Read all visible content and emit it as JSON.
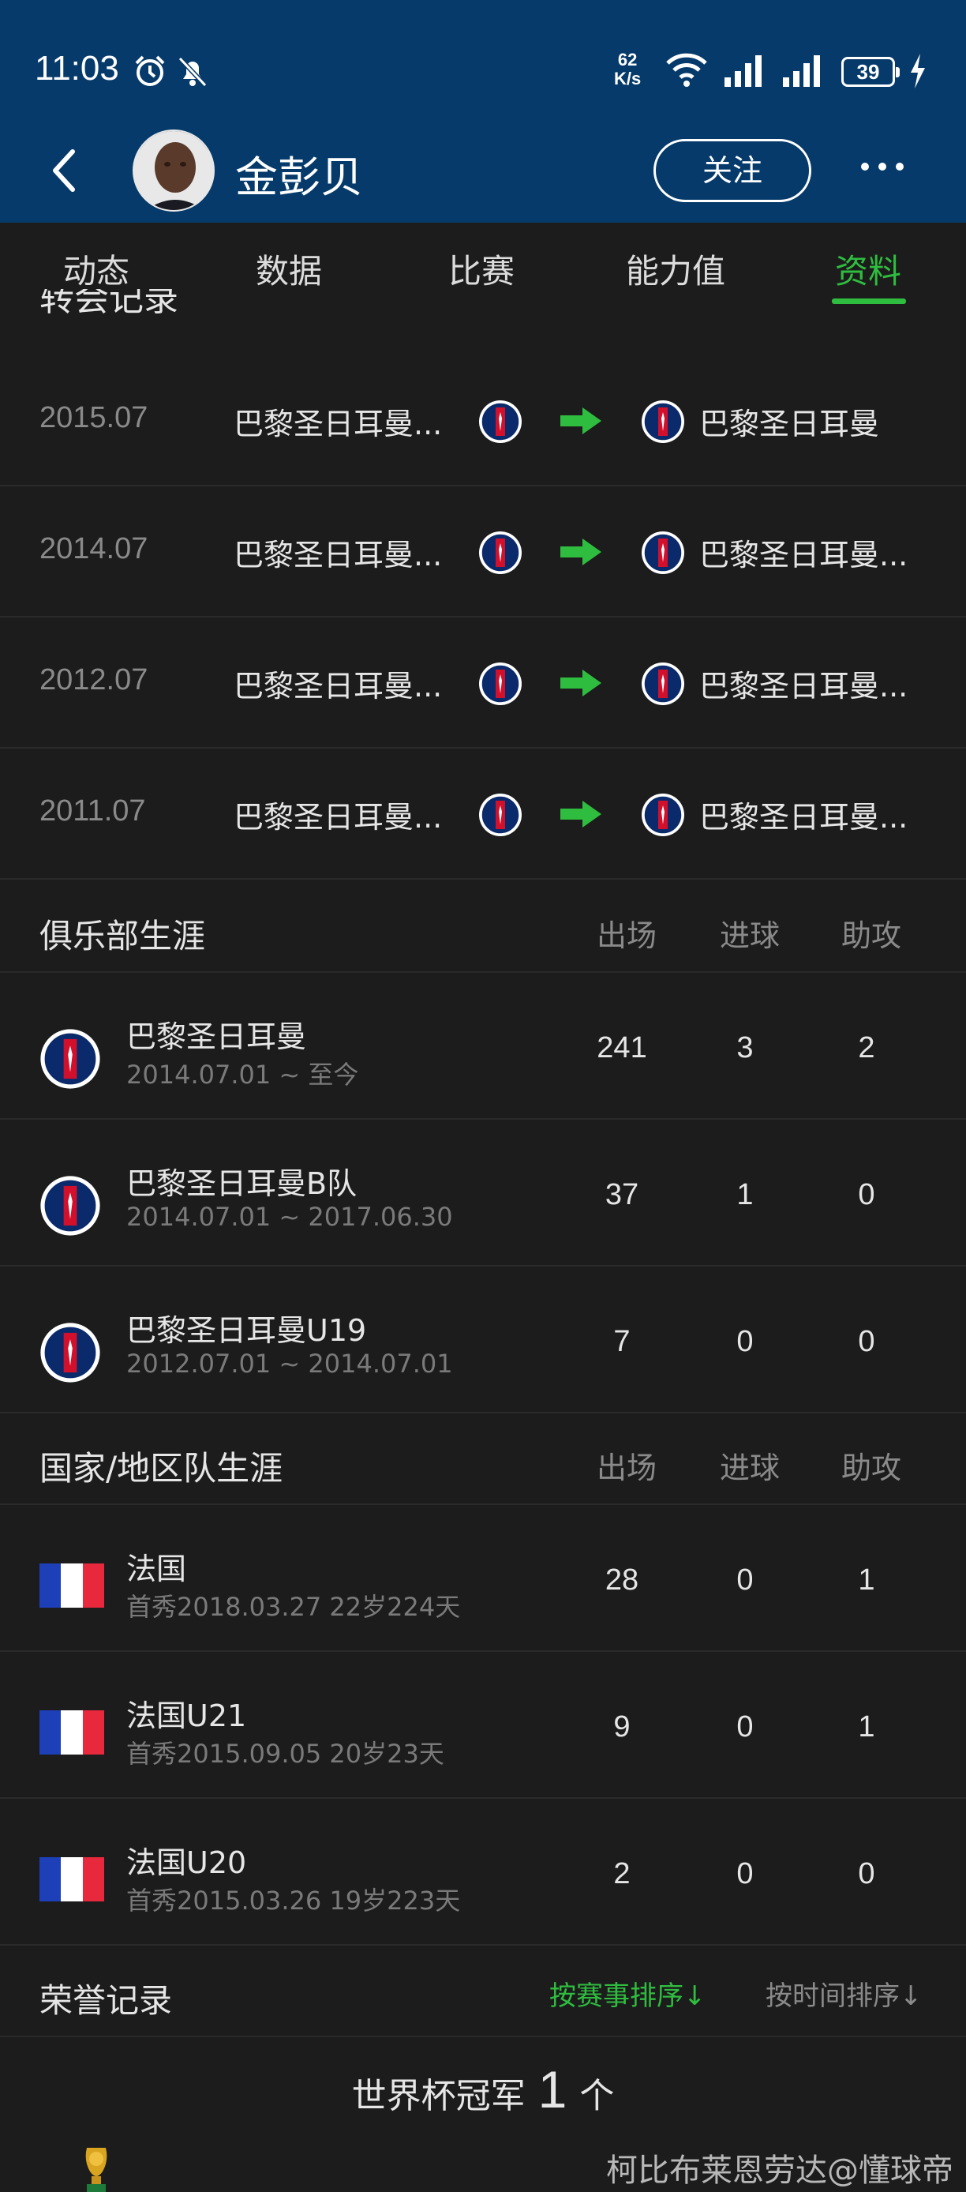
{
  "status": {
    "time": "11:03",
    "net_speed_value": "62",
    "net_speed_unit": "K/s",
    "battery": "39"
  },
  "header": {
    "name": "金彭贝",
    "follow": "关注"
  },
  "tabs": [
    {
      "label": "动态"
    },
    {
      "label": "数据"
    },
    {
      "label": "比赛"
    },
    {
      "label": "能力值"
    },
    {
      "label": "资料"
    }
  ],
  "active_tab": "资料",
  "transfer_section_title": "转会记录",
  "transfers": [
    {
      "date": "2015.07",
      "from": "巴黎圣日耳曼...",
      "to": "巴黎圣日耳曼"
    },
    {
      "date": "2014.07",
      "from": "巴黎圣日耳曼...",
      "to": "巴黎圣日耳曼..."
    },
    {
      "date": "2012.07",
      "from": "巴黎圣日耳曼...",
      "to": "巴黎圣日耳曼..."
    },
    {
      "date": "2011.07",
      "from": "巴黎圣日耳曼...",
      "to": "巴黎圣日耳曼..."
    }
  ],
  "club_career": {
    "title": "俱乐部生涯",
    "cols": {
      "apps": "出场",
      "goals": "进球",
      "assists": "助攻"
    },
    "rows": [
      {
        "name": "巴黎圣日耳曼",
        "period": "2014.07.01 ~ 至今",
        "apps": "241",
        "goals": "3",
        "assists": "2"
      },
      {
        "name": "巴黎圣日耳曼B队",
        "period": "2014.07.01 ~ 2017.06.30",
        "apps": "37",
        "goals": "1",
        "assists": "0"
      },
      {
        "name": "巴黎圣日耳曼U19",
        "period": "2012.07.01 ~ 2014.07.01",
        "apps": "7",
        "goals": "0",
        "assists": "0"
      }
    ]
  },
  "national_career": {
    "title": "国家/地区队生涯",
    "cols": {
      "apps": "出场",
      "goals": "进球",
      "assists": "助攻"
    },
    "rows": [
      {
        "name": "法国",
        "debut": "首秀2018.03.27 22岁224天",
        "apps": "28",
        "goals": "0",
        "assists": "1"
      },
      {
        "name": "法国U21",
        "debut": "首秀2015.09.05 20岁23天",
        "apps": "9",
        "goals": "0",
        "assists": "1"
      },
      {
        "name": "法国U20",
        "debut": "首秀2015.03.26 19岁223天",
        "apps": "2",
        "goals": "0",
        "assists": "0"
      }
    ]
  },
  "honors": {
    "title": "荣誉记录",
    "sort_by_event": "按赛事排序↓",
    "sort_by_time": "按时间排序↓",
    "world_cup_label": "世界杯冠军",
    "world_cup_count": "1",
    "world_cup_unit": "个"
  },
  "watermark": "柯比布莱恩劳达@懂球帝",
  "colors": {
    "header_bg": "#063a6a",
    "accent_green": "#2fbd3f",
    "psg_blue": "#0b2a6b",
    "psg_red": "#d3102c"
  },
  "icons": [
    "back-icon",
    "alarm-icon",
    "mute-icon",
    "wifi-icon",
    "signal-icon",
    "charging-icon",
    "more-icon",
    "psg-badge-icon",
    "transfer-arrow-icon",
    "france-flag-icon",
    "trophy-icon"
  ]
}
